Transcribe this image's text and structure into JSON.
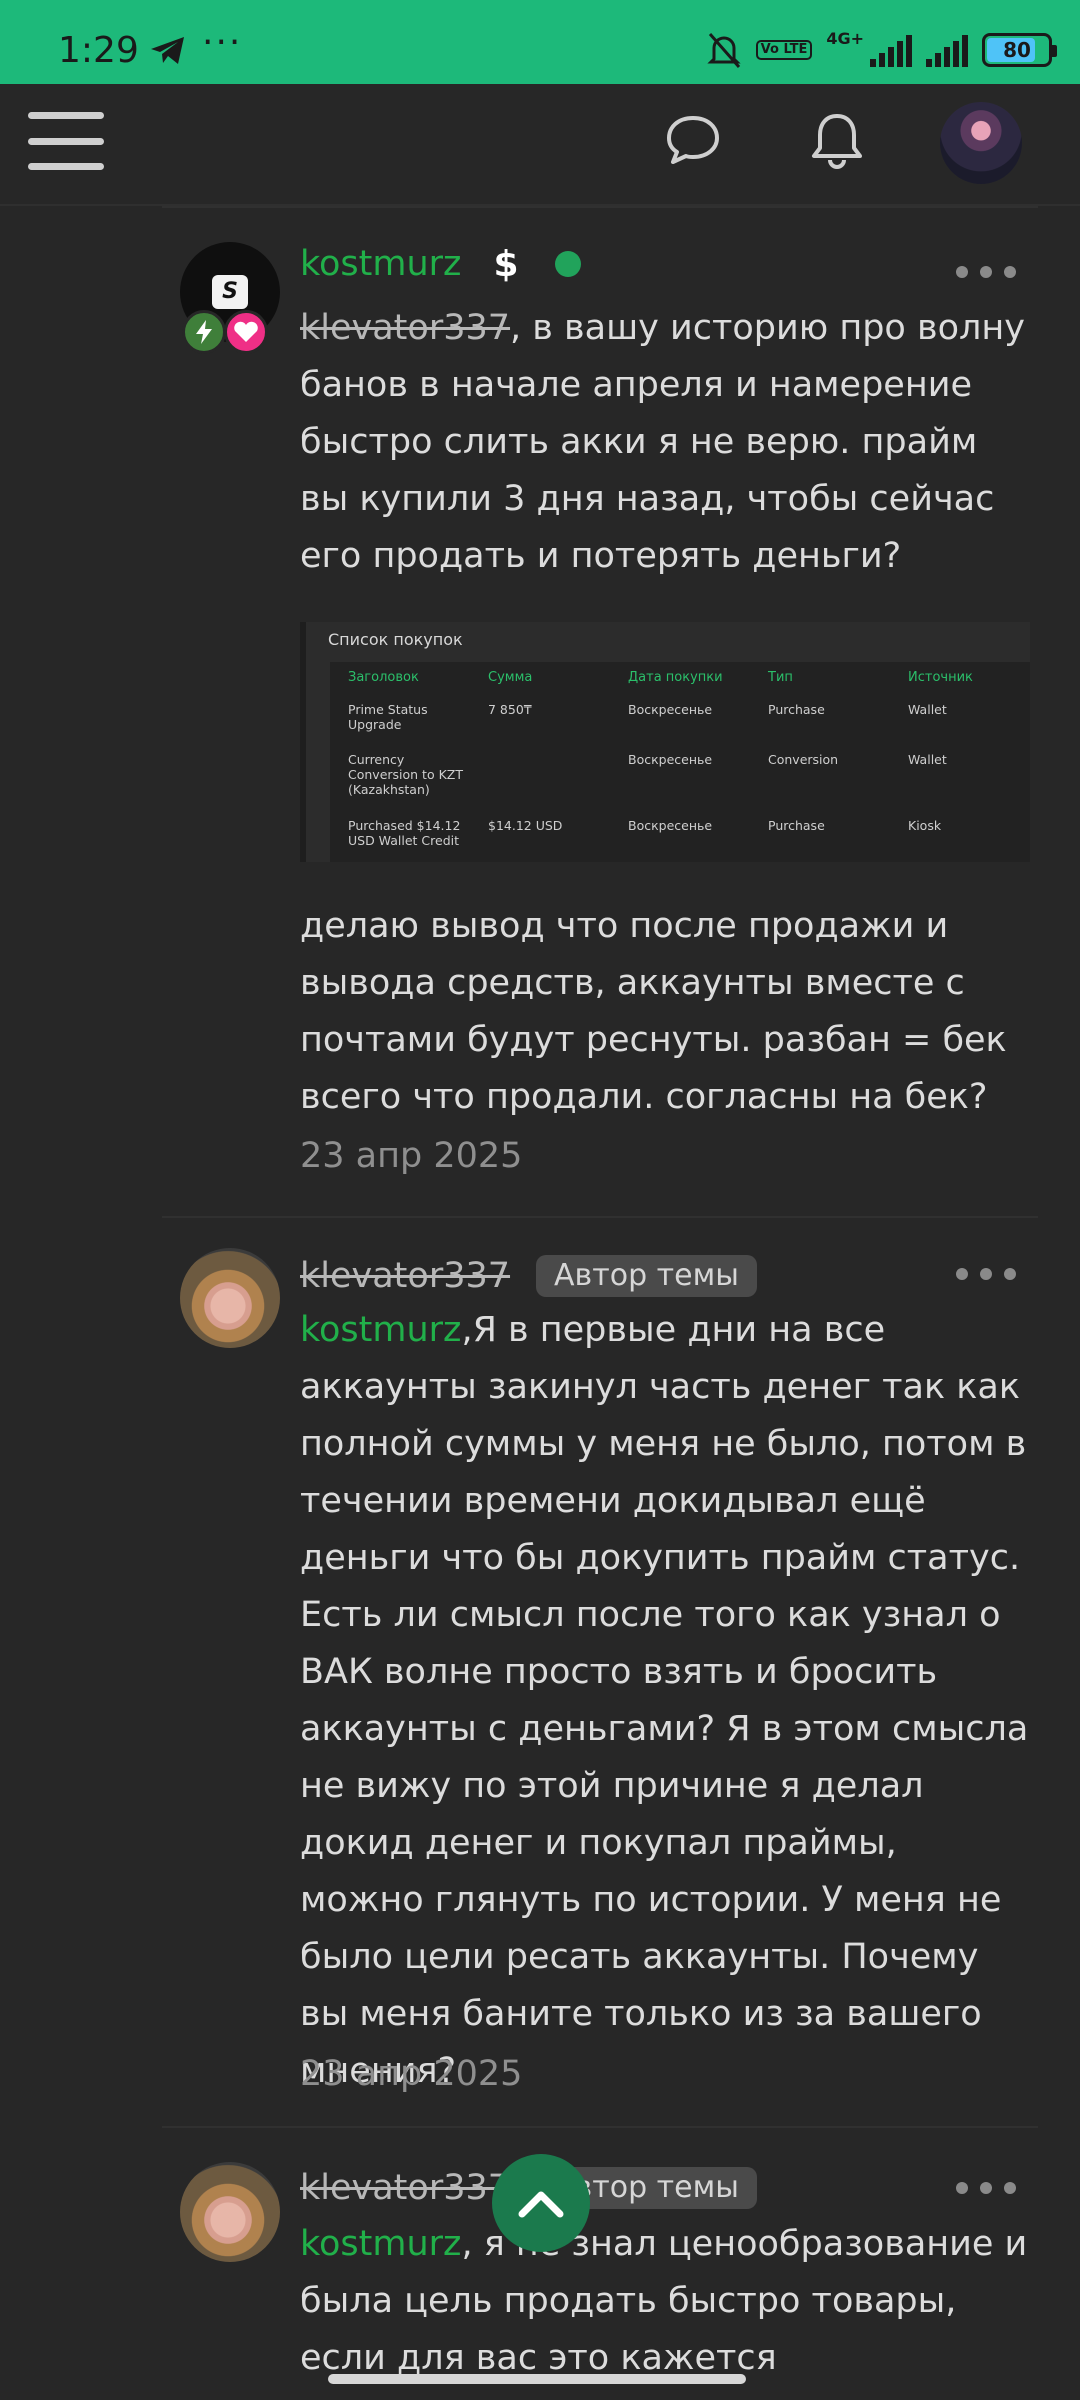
{
  "status_bar": {
    "time": "1:29",
    "more": "···",
    "net": "4G+",
    "volte": "Vo LTE",
    "battery": "80",
    "battery_level": 0.8
  },
  "header": {
    "menu_icon": "hamburger-icon",
    "chat_icon": "chat-bubble-icon",
    "bell_icon": "bell-icon",
    "avatar": "user-avatar"
  },
  "posts": [
    {
      "author": "kostmurz",
      "dollar": "$",
      "mention": "klevator337",
      "text1": ", в вашу историю про волну банов в начале апреля и намерение быстро слить акки я не верю. прайм вы купили 3 дня назад, чтобы сейчас его продать и потерять деньги?",
      "image": {
        "title": "Список покупок",
        "headers": [
          "Заголовок",
          "Сумма",
          "Дата покупки",
          "Тип",
          "Источник"
        ],
        "rows": [
          [
            "Prime Status Upgrade",
            "7 850₸",
            "Воскресенье",
            "Purchase",
            "Wallet"
          ],
          [
            "Currency Conversion to KZT (Kazakhstan)",
            "",
            "Воскресенье",
            "Conversion",
            "Wallet"
          ],
          [
            "Purchased $14.12 USD Wallet Credit",
            "$14.12 USD",
            "Воскресенье",
            "Purchase",
            "Kiosk"
          ]
        ]
      },
      "text2": "делаю вывод что после продажи и вывода средств, аккаунты вместе с почтами будут реснуты. разбан = бек всего что продали. согласны на бек?",
      "date": "23 апр 2025"
    },
    {
      "author": "klevator337",
      "badge": "Автор темы",
      "mention": "kostmurz",
      "text": ",Я в первые дни на все аккаунты закинул часть денег так как полной суммы у меня не было, потом в течении времени докидывал ещё деньги что бы докупить прайм статус. Есть ли смысл после того как узнал о ВАК волне просто взять и бросить аккаунты с деньгами? Я в этом смысла не вижу по этой причине я делал докид денег и покупал праймы, можно глянуть по истории. У меня не было цели ресать аккаунты. Почему вы меня баните только из за вашего мнения?",
      "date": "23 апр 2025"
    },
    {
      "author": "klevator337",
      "badge": "Автор темы",
      "mention": "kostmurz",
      "text": ", я не знал ценообразование и была цель продать быстро товары, если для вас это кажется"
    }
  ]
}
